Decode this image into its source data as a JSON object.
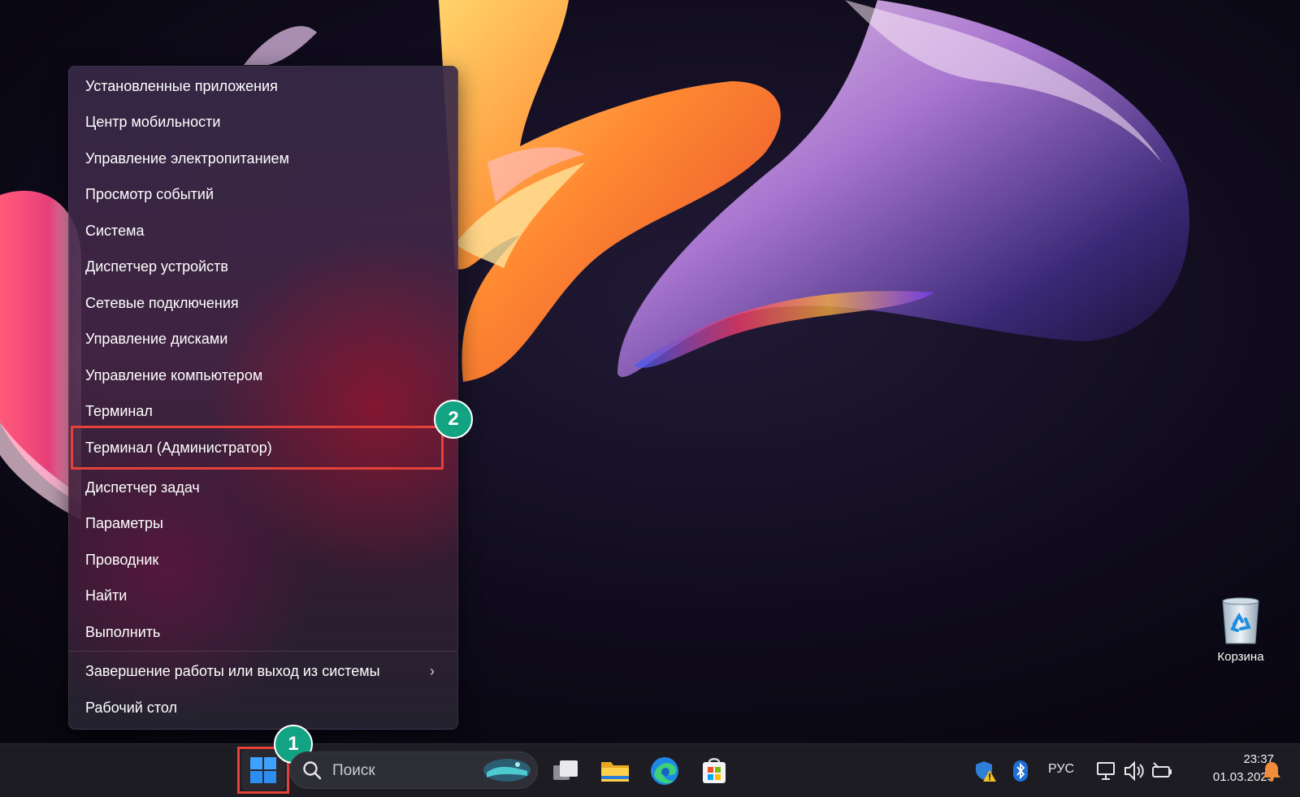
{
  "menu": {
    "items": [
      {
        "label": "Установленные приложения"
      },
      {
        "label": "Центр мобильности"
      },
      {
        "label": "Управление электропитанием"
      },
      {
        "label": "Просмотр событий"
      },
      {
        "label": "Система"
      },
      {
        "label": "Диспетчер устройств"
      },
      {
        "label": "Сетевые подключения"
      },
      {
        "label": "Управление дисками"
      },
      {
        "label": "Управление компьютером"
      },
      {
        "label": "Терминал"
      },
      {
        "label": "Терминал (Администратор)"
      },
      {
        "label": "Диспетчер задач"
      },
      {
        "label": "Параметры"
      },
      {
        "label": "Проводник"
      },
      {
        "label": "Найти"
      },
      {
        "label": "Выполнить"
      },
      {
        "label": "Завершение работы или выход из системы"
      },
      {
        "label": "Рабочий стол"
      }
    ],
    "submenu_chevron": "›"
  },
  "annotations": {
    "step1": "1",
    "step2": "2",
    "highlight_color": "#e5433a",
    "badge_color": "#12a383"
  },
  "desktop": {
    "recycle_bin_label": "Корзина"
  },
  "taskbar": {
    "search_label": "Поиск",
    "apps": [
      "windows-start-icon",
      "task-view-icon",
      "file-explorer-icon",
      "edge-icon",
      "store-icon"
    ],
    "tray": {
      "language": "РУС",
      "time": "23:37",
      "date": "01.03.2025"
    }
  }
}
